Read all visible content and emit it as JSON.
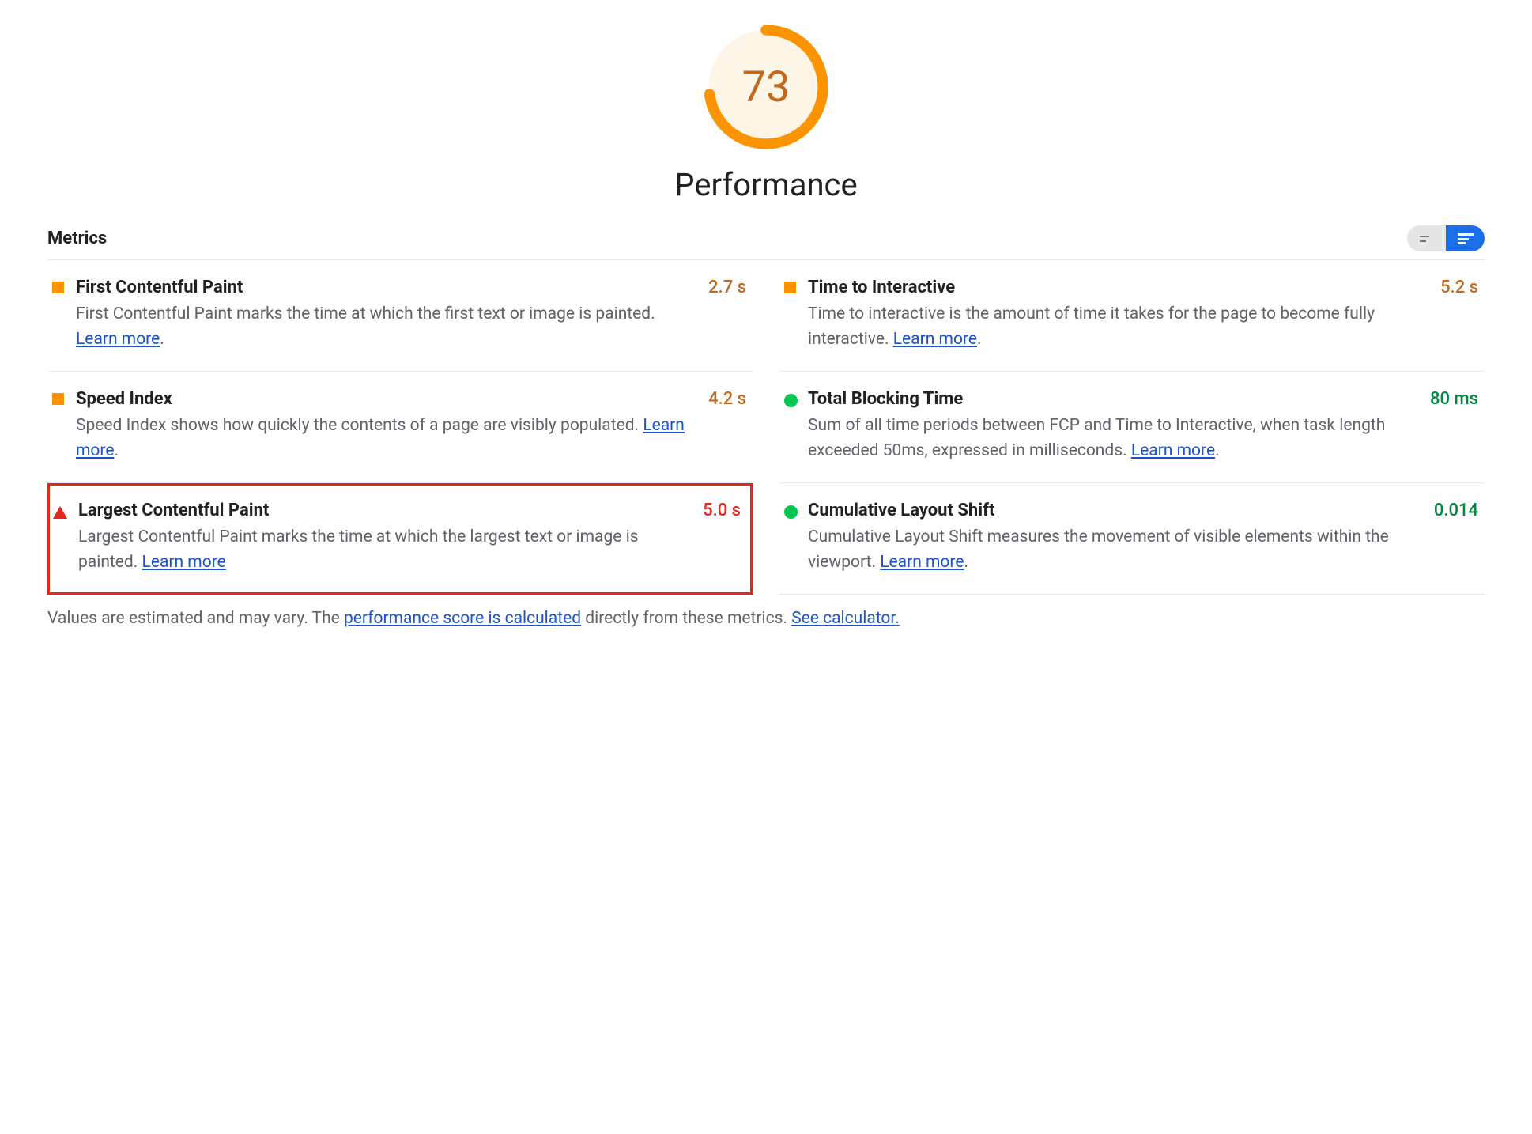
{
  "gauge": {
    "score": "73",
    "score_num": 73,
    "title": "Performance",
    "color": "#fb9400",
    "bg": "#fdf5e6"
  },
  "section_title": "Metrics",
  "learn_more_label": "Learn more",
  "metrics": [
    {
      "name": "First Contentful Paint",
      "value": "2.7 s",
      "value_class": "val-orange",
      "icon": "square",
      "desc_pre": "First Contentful Paint marks the time at which the first text or image is painted. ",
      "desc_post": ".",
      "highlight": false
    },
    {
      "name": "Time to Interactive",
      "value": "5.2 s",
      "value_class": "val-orange",
      "icon": "square",
      "desc_pre": "Time to interactive is the amount of time it takes for the page to become fully interactive. ",
      "desc_post": ".",
      "highlight": false
    },
    {
      "name": "Speed Index",
      "value": "4.2 s",
      "value_class": "val-orange",
      "icon": "square",
      "desc_pre": "Speed Index shows how quickly the contents of a page are visibly populated. ",
      "desc_post": ".",
      "highlight": false
    },
    {
      "name": "Total Blocking Time",
      "value": "80 ms",
      "value_class": "val-green",
      "icon": "circle",
      "desc_pre": "Sum of all time periods between FCP and Time to Interactive, when task length exceeded 50ms, expressed in milliseconds. ",
      "desc_post": ".",
      "highlight": false
    },
    {
      "name": "Largest Contentful Paint",
      "value": "5.0 s",
      "value_class": "val-red",
      "icon": "triangle",
      "desc_pre": "Largest Contentful Paint marks the time at which the largest text or image is painted. ",
      "desc_post": "",
      "highlight": true
    },
    {
      "name": "Cumulative Layout Shift",
      "value": "0.014",
      "value_class": "val-green",
      "icon": "circle",
      "desc_pre": "Cumulative Layout Shift measures the movement of visible elements within the viewport. ",
      "desc_post": ".",
      "highlight": false
    }
  ],
  "footnote": {
    "pre": "Values are estimated and may vary. The ",
    "link1": "performance score is calculated",
    "mid": " directly from these metrics. ",
    "link2": "See calculator."
  }
}
